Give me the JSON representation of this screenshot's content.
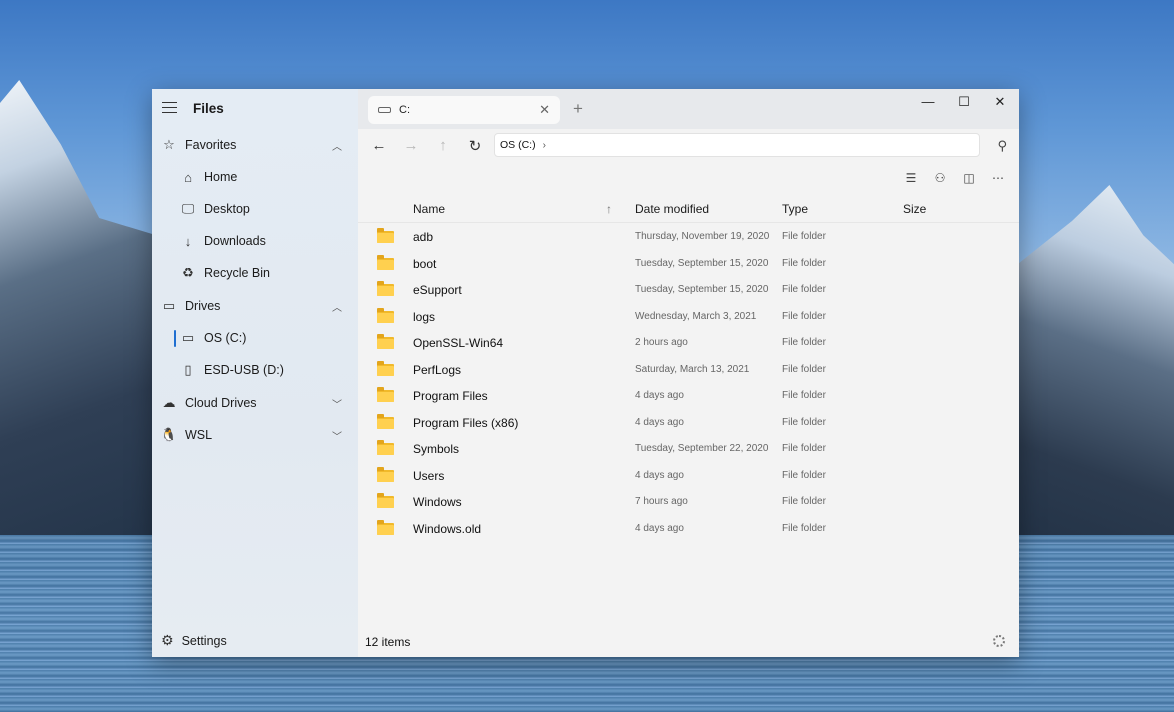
{
  "app": {
    "title": "Files"
  },
  "sidebar": {
    "favorites": {
      "label": "Favorites",
      "icon": "star-icon"
    },
    "favorite_items": [
      {
        "label": "Home",
        "icon": "home-icon"
      },
      {
        "label": "Desktop",
        "icon": "desktop-icon"
      },
      {
        "label": "Downloads",
        "icon": "download-icon"
      },
      {
        "label": "Recycle Bin",
        "icon": "recycle-bin-icon"
      }
    ],
    "drives": {
      "label": "Drives",
      "icon": "drive-icon"
    },
    "drive_items": [
      {
        "label": "OS (C:)",
        "icon": "hard-drive-icon",
        "selected": true
      },
      {
        "label": "ESD-USB (D:)",
        "icon": "usb-drive-icon",
        "selected": false
      }
    ],
    "cloud_drives": {
      "label": "Cloud Drives",
      "icon": "cloud-icon"
    },
    "wsl": {
      "label": "WSL",
      "icon": "linux-icon"
    },
    "settings": {
      "label": "Settings",
      "icon": "gear-icon"
    }
  },
  "tabs": [
    {
      "label": "C:"
    }
  ],
  "address": {
    "crumb": "OS (C:)",
    "separator": "›"
  },
  "columns": {
    "name": "Name",
    "date": "Date modified",
    "type": "Type",
    "size": "Size"
  },
  "files": [
    {
      "name": "adb",
      "date": "Thursday, November 19, 2020",
      "type": "File folder"
    },
    {
      "name": "boot",
      "date": "Tuesday, September 15, 2020",
      "type": "File folder"
    },
    {
      "name": "eSupport",
      "date": "Tuesday, September 15, 2020",
      "type": "File folder"
    },
    {
      "name": "logs",
      "date": "Wednesday, March 3, 2021",
      "type": "File folder"
    },
    {
      "name": "OpenSSL-Win64",
      "date": "2 hours ago",
      "type": "File folder"
    },
    {
      "name": "PerfLogs",
      "date": "Saturday, March 13, 2021",
      "type": "File folder"
    },
    {
      "name": "Program Files",
      "date": "4 days ago",
      "type": "File folder"
    },
    {
      "name": "Program Files (x86)",
      "date": "4 days ago",
      "type": "File folder"
    },
    {
      "name": "Symbols",
      "date": "Tuesday, September 22, 2020",
      "type": "File folder"
    },
    {
      "name": "Users",
      "date": "4 days ago",
      "type": "File folder"
    },
    {
      "name": "Windows",
      "date": "7 hours ago",
      "type": "File folder"
    },
    {
      "name": "Windows.old",
      "date": "4 days ago",
      "type": "File folder"
    }
  ],
  "status": {
    "item_count": "12 items"
  },
  "colors": {
    "accent": "#1f6fd1",
    "folder": "#ffd04f"
  }
}
